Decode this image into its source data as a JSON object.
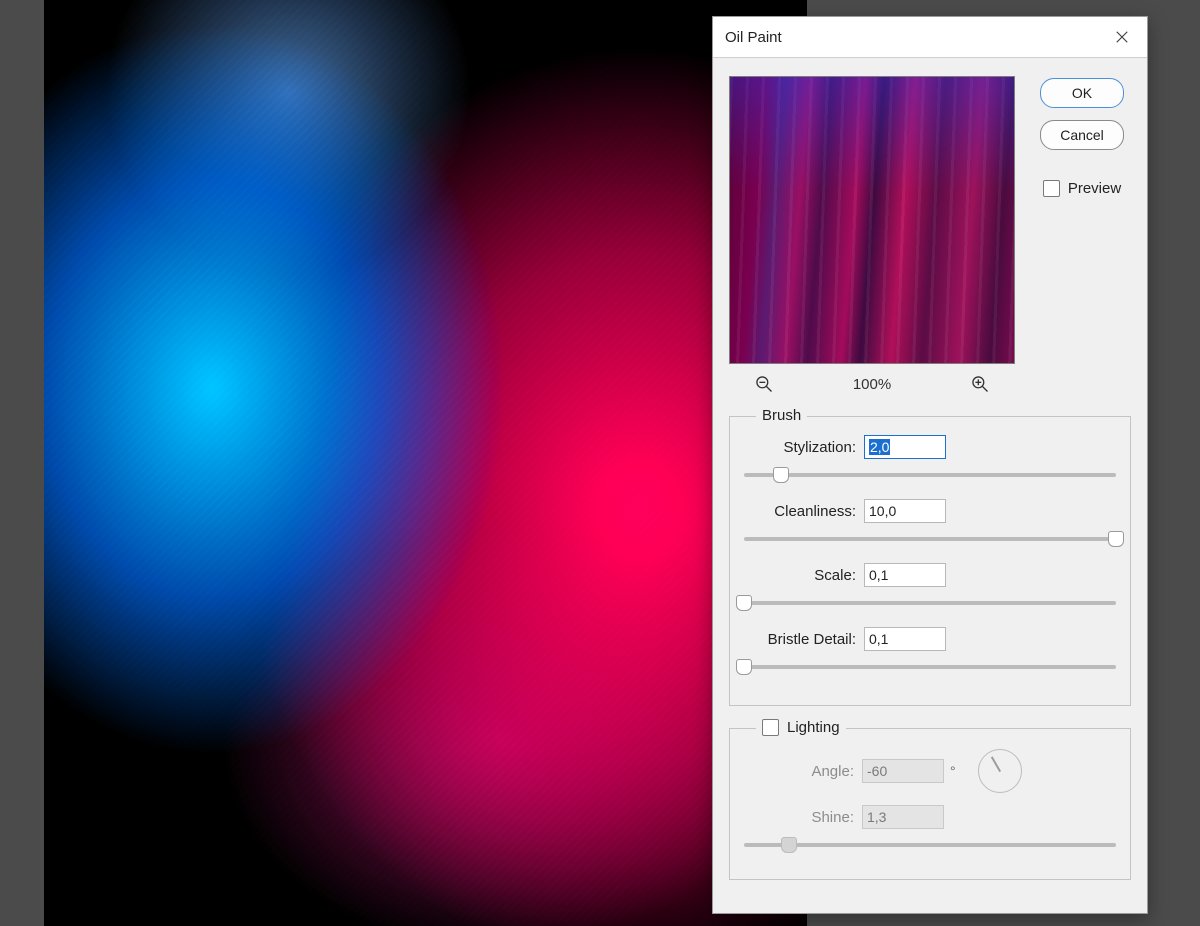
{
  "dialog": {
    "title": "Oil Paint",
    "buttons": {
      "ok": "OK",
      "cancel": "Cancel"
    },
    "preview_checkbox_label": "Preview",
    "preview_checked": false,
    "zoom_level": "100%"
  },
  "brush": {
    "legend": "Brush",
    "stylization": {
      "label": "Stylization:",
      "value": "2,0",
      "slider_pct": 10
    },
    "cleanliness": {
      "label": "Cleanliness:",
      "value": "10,0",
      "slider_pct": 100
    },
    "scale": {
      "label": "Scale:",
      "value": "0,1",
      "slider_pct": 0
    },
    "bristle": {
      "label": "Bristle Detail:",
      "value": "0,1",
      "slider_pct": 0
    }
  },
  "lighting": {
    "legend": "Lighting",
    "enabled": false,
    "angle": {
      "label": "Angle:",
      "value": "-60",
      "unit": "°",
      "dial_css_rotate": 240
    },
    "shine": {
      "label": "Shine:",
      "value": "1,3",
      "slider_pct": 12
    }
  }
}
